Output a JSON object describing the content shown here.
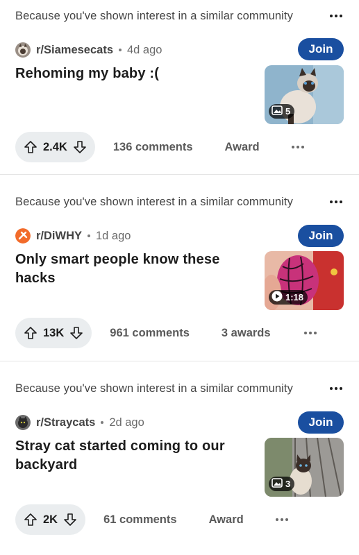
{
  "posts": [
    {
      "reason": "Because you've shown interest in a similar community",
      "subreddit": "r/Siamesecats",
      "age": "4d ago",
      "join_label": "Join",
      "title": "Rehoming my baby :(",
      "media_type": "gallery",
      "media_count": "5",
      "score": "2.4K",
      "comments": "136 comments",
      "award": "Award"
    },
    {
      "reason": "Because you've shown interest in a similar community",
      "subreddit": "r/DiWHY",
      "age": "1d ago",
      "join_label": "Join",
      "title": "Only smart people know these hacks",
      "media_type": "video",
      "media_count": "1:18",
      "score": "13K",
      "comments": "961 comments",
      "award": "3 awards"
    },
    {
      "reason": "Because you've shown interest in a similar community",
      "subreddit": "r/Straycats",
      "age": "2d ago",
      "join_label": "Join",
      "title": "Stray cat started coming to our backyard",
      "media_type": "gallery",
      "media_count": "3",
      "score": "2K",
      "comments": "61 comments",
      "award": "Award"
    }
  ],
  "colors": {
    "join_bg": "#1a4fa0",
    "vote_pill_bg": "#eaedef",
    "diwhy_orange": "#f26b2a"
  }
}
